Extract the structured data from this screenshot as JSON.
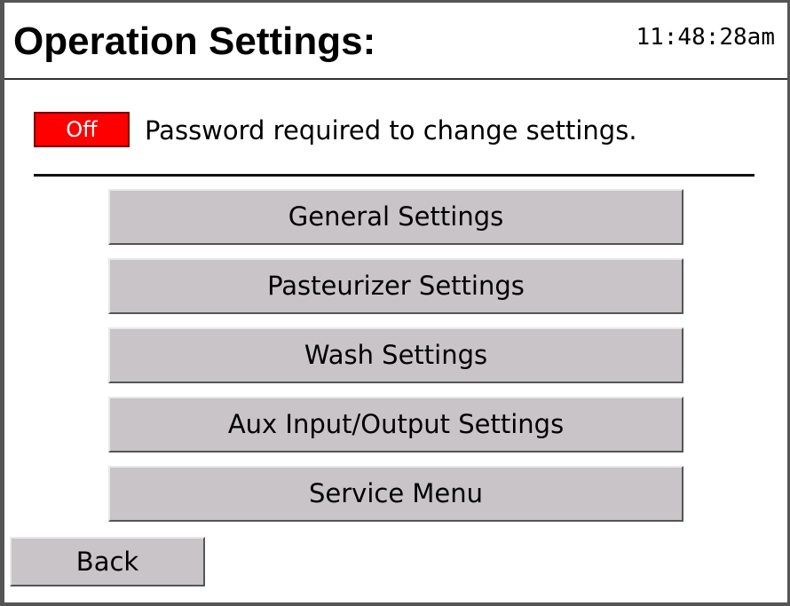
{
  "header": {
    "title": "Operation Settings:",
    "time": "11:48:28am"
  },
  "password": {
    "toggle_state": "Off",
    "toggle_color": "#ff0000",
    "description": "Password required to change settings."
  },
  "menu": {
    "items": [
      {
        "label": "General Settings"
      },
      {
        "label": "Pasteurizer Settings"
      },
      {
        "label": "Wash Settings"
      },
      {
        "label": "Aux Input/Output Settings"
      },
      {
        "label": "Service Menu"
      }
    ]
  },
  "footer": {
    "back_label": "Back"
  }
}
